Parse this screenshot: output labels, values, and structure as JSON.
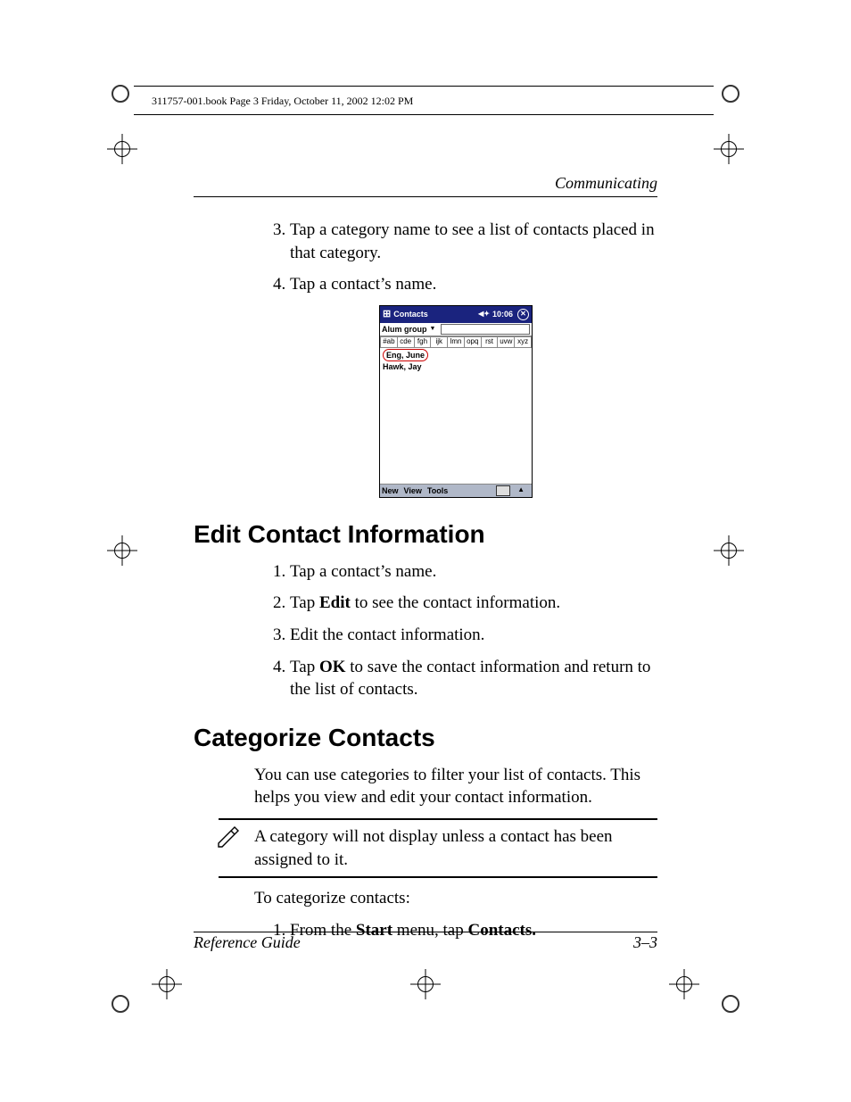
{
  "bookline": "311757-001.book  Page 3  Friday, October 11, 2002  12:02 PM",
  "runhead": "Communicating",
  "steps_top": [
    {
      "n": 3,
      "text": "Tap a category name to see a list of contacts placed in that category."
    },
    {
      "n": 4,
      "text": "Tap a contact’s name."
    }
  ],
  "screenshot": {
    "title": "Contacts",
    "time": "10:06",
    "group": "Alum group",
    "tabs": [
      "#ab",
      "cde",
      "fgh",
      "ijk",
      "lmn",
      "opq",
      "rst",
      "uvw",
      "xyz"
    ],
    "rows": [
      "Eng, June",
      "Hawk, Jay"
    ],
    "menu": [
      "New",
      "View",
      "Tools"
    ]
  },
  "section1": {
    "heading": "Edit Contact Information",
    "steps": [
      "Tap a contact’s name.",
      "Tap <b>Edit</b> to see the contact information.",
      "Edit the contact information.",
      "Tap <b>OK</b> to save the contact information and return to the list of contacts."
    ]
  },
  "section2": {
    "heading": "Categorize Contacts",
    "intro": "You can use categories to filter your list of contacts. This helps you view and edit your contact information.",
    "note": "A category will not display unless a contact has been assigned to it.",
    "lead": "To categorize contacts:",
    "steps": [
      "From the <b>Start</b> menu, tap <b>Contacts.</b>"
    ]
  },
  "footer": {
    "left": "Reference Guide",
    "right": "3–3"
  }
}
